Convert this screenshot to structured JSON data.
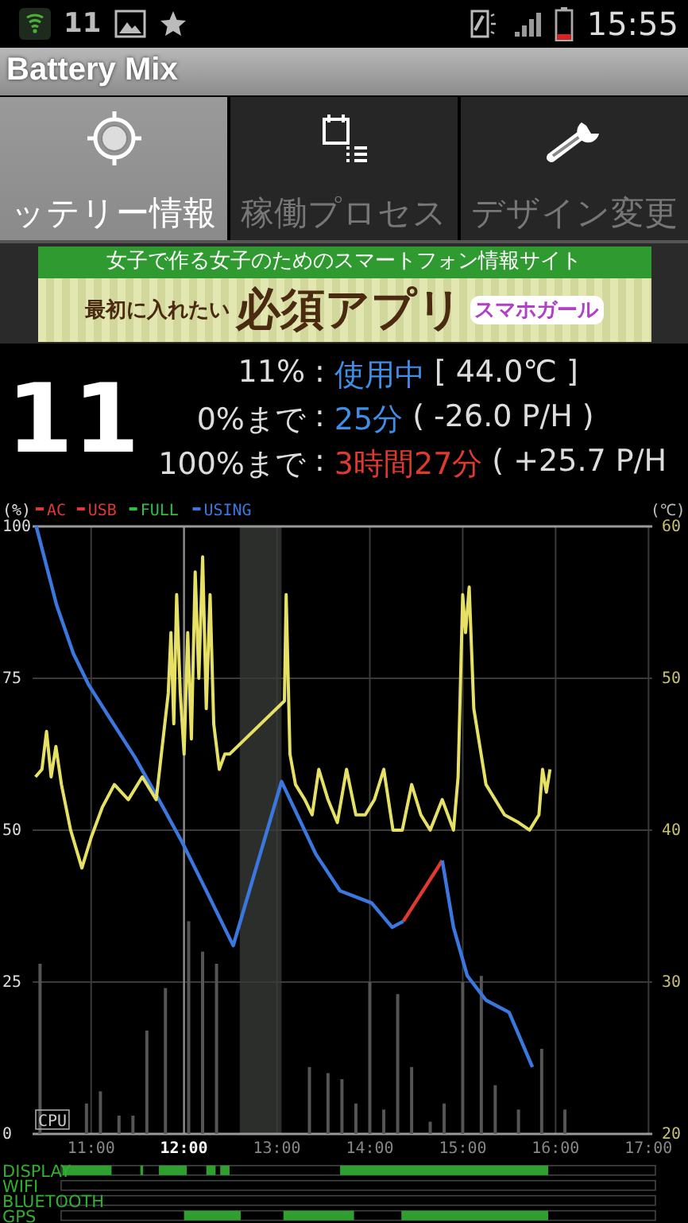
{
  "status_bar": {
    "notification_count": "11",
    "time": "15:55"
  },
  "app_bar": {
    "title": "Battery Mix"
  },
  "tabs": [
    {
      "label": "ッテリー情報",
      "selected": true
    },
    {
      "label": "稼働プロセス",
      "selected": false
    },
    {
      "label": "デザイン変更",
      "selected": false
    }
  ],
  "ad_banner": {
    "tagline": "女子で作る女子のためのスマートフォン情報サイト",
    "lead": "最初に入れたい",
    "headline": "必須アプリ",
    "brand": "スマホガール"
  },
  "battery": {
    "level_text": "11",
    "rows": [
      {
        "label": "11%",
        "separator": ":",
        "value": "使用中",
        "color": "#3f8fe8",
        "detail": "[ 44.0℃ ]"
      },
      {
        "label": "0%まで",
        "separator": ":",
        "value": "25分",
        "color": "#3f8fe8",
        "detail": "( -26.0 P/H )"
      },
      {
        "label": "100%まで",
        "separator": ":",
        "value": "3時間27分",
        "color": "#e03a30",
        "detail": "( +25.7 P/H"
      }
    ]
  },
  "chart": {
    "chart_data": {
      "type": "line",
      "ylabel": "(%)",
      "y2label": "(℃)",
      "xlim": [
        10.37,
        17.04
      ],
      "ylim": [
        0,
        100
      ],
      "y2lim": [
        20,
        60
      ],
      "grid": true,
      "legend": true,
      "y2ticks": [
        {
          "value": 20,
          "label": "20"
        },
        {
          "value": 30,
          "label": "30"
        },
        {
          "value": 40,
          "label": "40"
        },
        {
          "value": 50,
          "label": "50"
        },
        {
          "value": 60,
          "label": "60"
        }
      ],
      "yticks": [
        {
          "value": 0,
          "label": "0"
        },
        {
          "value": 25,
          "label": "25"
        },
        {
          "value": 50,
          "label": "50"
        },
        {
          "value": 75,
          "label": "75"
        },
        {
          "value": 100,
          "label": "100"
        }
      ],
      "xticks": [
        {
          "value": 11,
          "label": "11:00"
        },
        {
          "value": 12,
          "label": "12:00"
        },
        {
          "value": 13,
          "label": "13:00"
        },
        {
          "value": 14,
          "label": "14:00"
        },
        {
          "value": 15,
          "label": "15:00"
        },
        {
          "value": 16,
          "label": "16:00"
        },
        {
          "value": 17,
          "label": "17:00"
        }
      ],
      "ref_lines": [
        {
          "value": 12,
          "axis": "x"
        }
      ],
      "series": [
        {
          "name": "AC",
          "color": "#e03a30",
          "type": "line",
          "x": [
            14.36,
            14.78
          ],
          "values": [
            35,
            45
          ]
        },
        {
          "name": "USB",
          "color": "#e03a30",
          "type": "line"
        },
        {
          "name": "FULL",
          "color": "#30c040",
          "type": "line"
        },
        {
          "name": "USING",
          "color": "#3a78e0",
          "type": "line",
          "x": [
            10.41,
            10.63,
            10.81,
            10.97,
            11.22,
            11.47,
            11.73,
            11.98,
            12.24,
            12.53,
            13.05,
            13.42,
            13.68,
            14.02,
            14.24,
            14.36,
            null,
            14.78,
            14.9,
            15.05,
            15.25,
            15.5,
            15.75
          ],
          "values": [
            100,
            87,
            79,
            74,
            68,
            62,
            55,
            48,
            40,
            31,
            58,
            46,
            40,
            38,
            34,
            35,
            null,
            45,
            34,
            26,
            22,
            20,
            11
          ]
        },
        {
          "color": "#e6e064",
          "type": "line",
          "axis": "y2",
          "x": [
            10.4,
            10.47,
            10.52,
            10.57,
            10.62,
            10.68,
            10.78,
            10.9,
            11.0,
            11.12,
            11.25,
            11.4,
            11.55,
            11.7,
            11.83,
            11.86,
            11.89,
            11.92,
            11.96,
            12.0,
            12.04,
            12.08,
            12.12,
            12.16,
            12.2,
            12.24,
            12.28,
            12.32,
            12.38,
            12.44,
            12.49,
            13.08,
            13.1,
            13.14,
            13.2,
            13.3,
            13.38,
            13.45,
            13.55,
            13.65,
            13.75,
            13.85,
            13.95,
            14.05,
            14.15,
            14.25,
            14.35,
            14.45,
            14.55,
            14.65,
            14.78,
            14.9,
            14.95,
            14.98,
            15.0,
            15.03,
            15.07,
            15.12,
            15.25,
            15.45,
            15.6,
            15.72,
            15.82,
            15.86,
            15.9,
            15.94
          ],
          "values": [
            43.5,
            44,
            46.5,
            43.5,
            45.5,
            43,
            40,
            37.5,
            39.5,
            41.5,
            43,
            42,
            43.5,
            42,
            49,
            53,
            47,
            55.5,
            49,
            45,
            53,
            46,
            57,
            50,
            58,
            48,
            55.5,
            47,
            44,
            45,
            45,
            48.5,
            55.5,
            45,
            43,
            42,
            41,
            44,
            42,
            40.5,
            44,
            41,
            41,
            42,
            44,
            40,
            40,
            43,
            41,
            40,
            42,
            40,
            43.5,
            50.5,
            55.5,
            53,
            56,
            48,
            43,
            41,
            40.5,
            40,
            41,
            44,
            42.5,
            44
          ]
        },
        {
          "name": "CPU",
          "color": "#555555",
          "type": "bar",
          "x": [
            10.45,
            10.95,
            11.1,
            11.3,
            11.45,
            11.6,
            11.8,
            12.05,
            12.2,
            12.35,
            13.35,
            13.55,
            13.7,
            13.85,
            14.0,
            14.15,
            14.3,
            14.45,
            14.65,
            14.8,
            15.0,
            15.2,
            15.35,
            15.6,
            15.85,
            16.1
          ],
          "values": [
            28,
            5,
            7,
            3,
            3,
            17,
            24,
            35,
            30,
            28,
            11,
            10,
            9,
            5,
            25,
            4,
            23,
            11,
            2,
            5,
            25,
            26,
            8,
            4,
            14,
            4
          ]
        }
      ]
    }
  },
  "activity": {
    "lanes": [
      "DISPLAY",
      "WIFI",
      "BLUETOOTH",
      "GPS"
    ]
  }
}
